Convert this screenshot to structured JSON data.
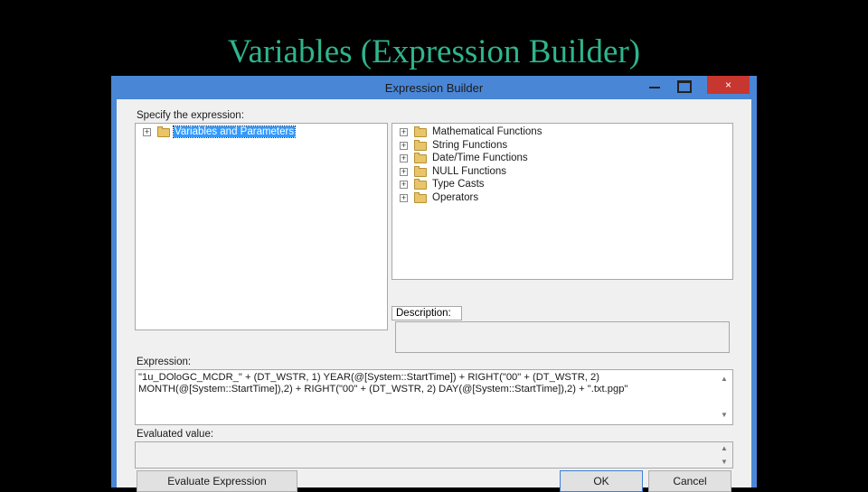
{
  "slide": {
    "title": "Variables (Expression Builder)"
  },
  "window": {
    "title": "Expression Builder",
    "close_glyph": "×"
  },
  "left_panel": {
    "label": "Specify the expression:",
    "items": [
      {
        "label": "Variables and Parameters"
      }
    ]
  },
  "function_tree": {
    "items": [
      {
        "label": "Mathematical Functions"
      },
      {
        "label": "String Functions"
      },
      {
        "label": "Date/Time Functions"
      },
      {
        "label": "NULL Functions"
      },
      {
        "label": "Type Casts"
      },
      {
        "label": "Operators"
      }
    ]
  },
  "description": {
    "tab_label": "Description:",
    "value": ""
  },
  "expression": {
    "label": "Expression:",
    "line1": "\"1u_DOloGC_MCDR_\" + (DT_WSTR, 1) YEAR(@[System::StartTime]) + RIGHT(\"00\" + (DT_WSTR, 2)",
    "line2": "MONTH(@[System::StartTime]),2) + RIGHT(\"00\" + (DT_WSTR, 2) DAY(@[System::StartTime]),2) + \".txt.pgp\""
  },
  "evaluated": {
    "label": "Evaluated value:",
    "value": ""
  },
  "buttons": {
    "evaluate": "Evaluate Expression",
    "ok": "OK",
    "cancel": "Cancel"
  },
  "colors": {
    "title_green": "#2fb58d",
    "window_frame": "#4a86d6",
    "close_red": "#c7372f",
    "selection": "#3399ff"
  },
  "icons": {
    "expand": "plus-box-icon",
    "folder": "folder-icon",
    "open_folder": "open-folder-icon"
  }
}
